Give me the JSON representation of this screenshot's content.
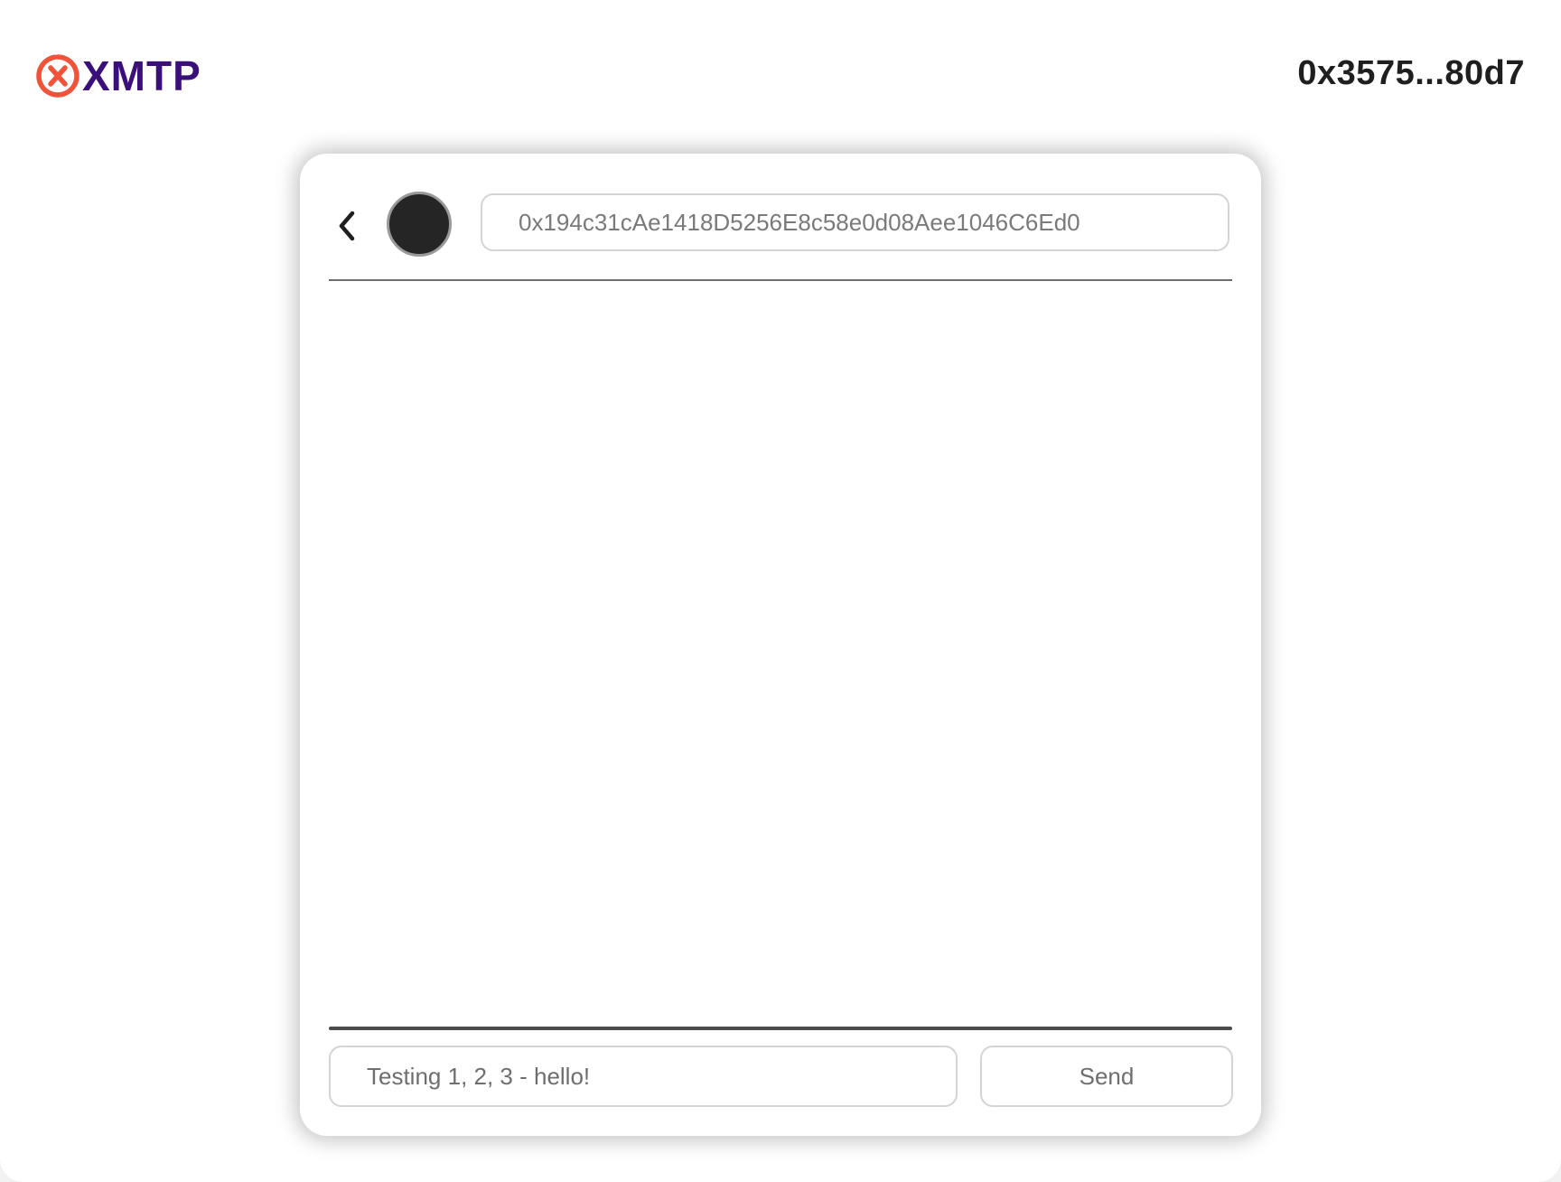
{
  "header": {
    "logo_text": "XMTP",
    "logo_icon": "xmtp-x-mark-icon",
    "account_address": "0x3575...80d7",
    "brand_color": "#3b0f7a",
    "accent_color": "#f0533a"
  },
  "conversation": {
    "back_icon": "chevron-left-icon",
    "recipient_address": "0x194c31cAe1418D5256E8c58e0d08Aee1046C6Ed0",
    "messages": []
  },
  "composer": {
    "placeholder": "Testing 1, 2, 3 - hello!",
    "value": "",
    "send_label": "Send"
  }
}
